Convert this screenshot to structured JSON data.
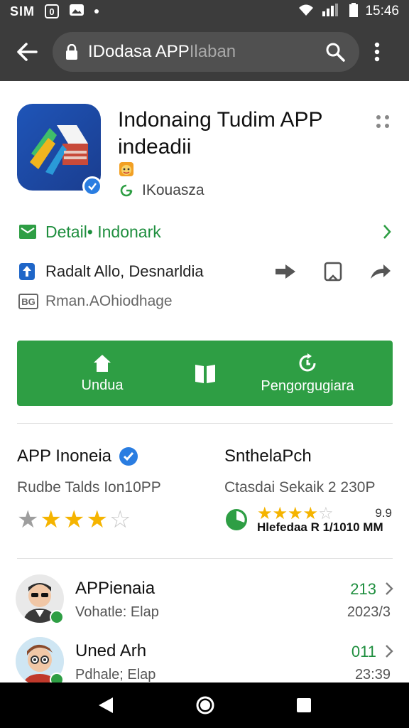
{
  "status_bar": {
    "carrier": "SIM",
    "notification_badge": "0",
    "time": "15:46"
  },
  "top_bar": {
    "search_text": "IDodasa APP",
    "search_text_dim": "Ilaban"
  },
  "app": {
    "title_line1": "Indonaing Tudim APP",
    "title_line2": "indeadii",
    "developer": "IKouasza",
    "detail_text": "Detail• Indonark",
    "meta_text": "Radalt Allo, Desnarldia",
    "category_badge": "BG",
    "category_text": "Rman.AOhiodhage"
  },
  "actions": {
    "install_label": "Undua",
    "bookmark_label": "",
    "update_label": "Pengorgugiara"
  },
  "stats": {
    "left_title": "APP Inoneia",
    "left_sub": "Rudbe Talds  Ion10PP",
    "left_stars": 3.5,
    "right_title": "SnthelaPch",
    "right_sub": "Ctasdai Sekaik 2 230P",
    "right_rating": "9.9",
    "right_footer": "Hlefedaa R 1/1010 MM",
    "right_stars": 3.5
  },
  "reviews": [
    {
      "name": "APPienaia",
      "sub": "Vohatle: Elap",
      "count": "213",
      "date": "2023/3"
    },
    {
      "name": "Uned Arh",
      "sub": "Pdhale; Elap",
      "count": "011",
      "date": "23:39"
    }
  ],
  "colors": {
    "accent_green": "#2e9e44",
    "link_green": "#1e8e3e",
    "toolbar": "#3c3c3c",
    "star": "#f5b400"
  }
}
